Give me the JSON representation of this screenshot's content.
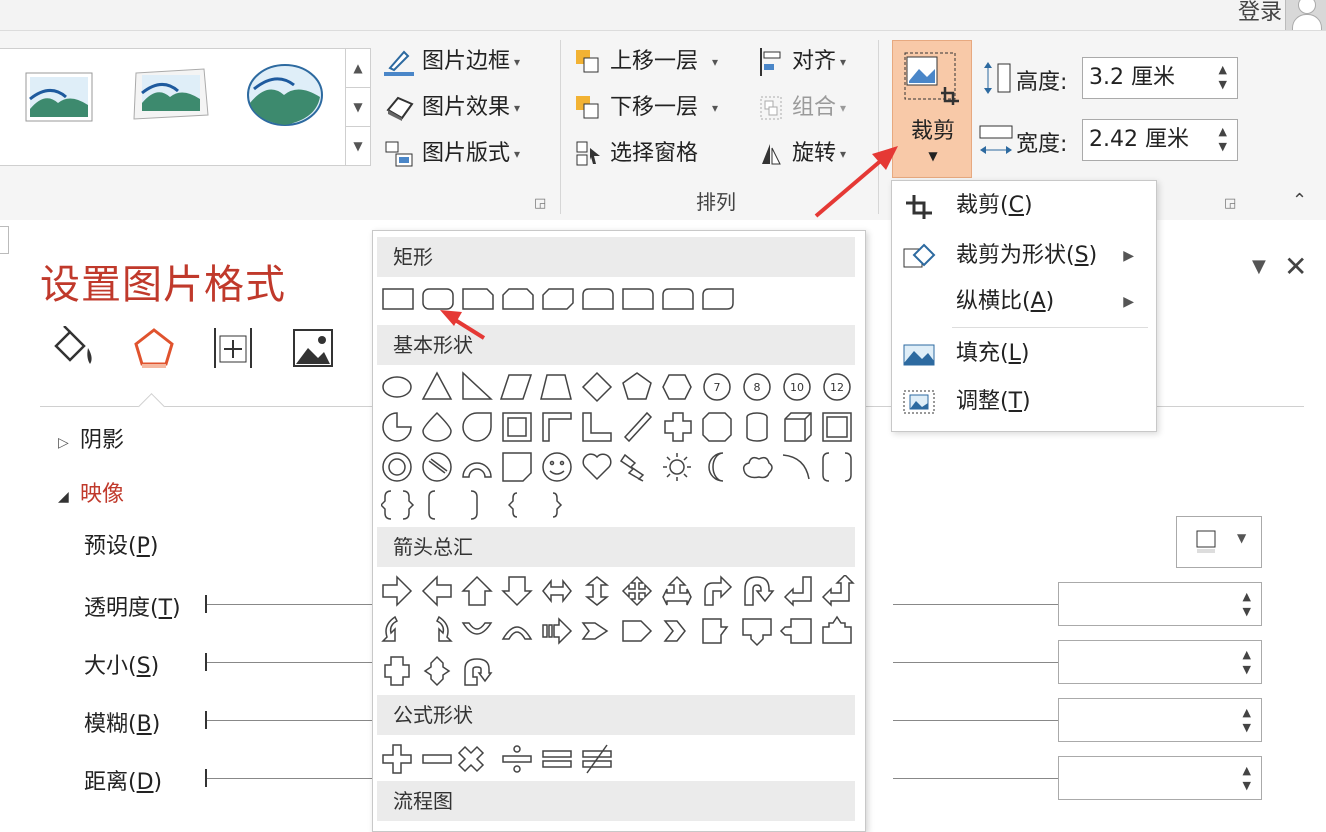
{
  "header": {
    "login": "登录"
  },
  "ribbon": {
    "picture_styles": {
      "border": "图片边框",
      "effects": "图片效果",
      "layout": "图片版式"
    },
    "arrange": {
      "bring_forward": "上移一层",
      "send_backward": "下移一层",
      "selection_pane": "选择窗格",
      "align": "对齐",
      "group": "组合",
      "rotate": "旋转",
      "group_label": "排列"
    },
    "crop": {
      "label": "裁剪"
    },
    "size": {
      "height_label": "高度:",
      "height_value": "3.2 厘米",
      "width_label": "宽度:",
      "width_value": "2.42 厘米"
    }
  },
  "crop_menu": {
    "items": [
      {
        "label": "裁剪(",
        "key": "C"
      },
      {
        "label": "裁剪为形状(",
        "key": "S"
      },
      {
        "label": "纵横比(",
        "key": "A"
      },
      {
        "label": "填充(",
        "key": "L"
      },
      {
        "label": "调整(",
        "key": "T"
      }
    ]
  },
  "shape_menu": {
    "categories": [
      "矩形",
      "基本形状",
      "箭头总汇",
      "公式形状",
      "流程图"
    ],
    "octagon_labels": [
      "7",
      "8",
      "10",
      "12"
    ]
  },
  "pane": {
    "title": "设置图片格式",
    "sections": {
      "shadow": "阴影",
      "reflection": "映像"
    },
    "rows": [
      {
        "label": "预设(",
        "key": "P"
      },
      {
        "label": "透明度(",
        "key": "T"
      },
      {
        "label": "大小(",
        "key": "S"
      },
      {
        "label": "模糊(",
        "key": "B"
      },
      {
        "label": "距离(",
        "key": "D"
      }
    ]
  },
  "colors": {
    "accent": "#c0392b",
    "crop_highlight": "#f8c9a8",
    "annotation_red": "#e53935"
  }
}
